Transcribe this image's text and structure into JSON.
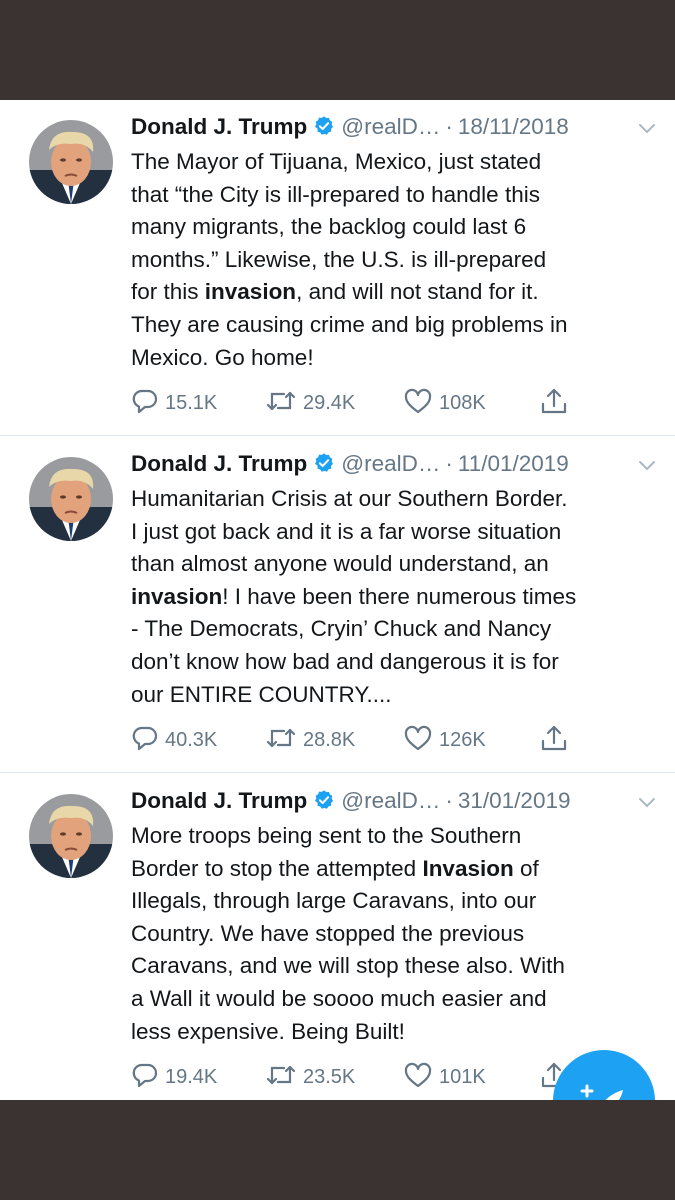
{
  "tweets": [
    {
      "name": "Donald J. Trump",
      "handle": "@realD…",
      "date": "18/11/2018",
      "lines": [
        "The Mayor of Tijuana, Mexico, just stated",
        "that “the City is ill-prepared to handle this",
        "many migrants, the backlog could last 6",
        "months.” Likewise, the U.S. is ill-prepared",
        [
          "for this ",
          "invasion",
          ", and will not stand for it."
        ],
        "They are causing crime and big problems in",
        "Mexico. Go home!"
      ],
      "replies": "15.1K",
      "retweets": "29.4K",
      "likes": "108K"
    },
    {
      "name": "Donald J. Trump",
      "handle": "@realD…",
      "date": "11/01/2019",
      "lines": [
        "Humanitarian Crisis at our Southern Border.",
        "I just got back and it is a far worse situation",
        "than almost anyone would understand, an",
        [
          "",
          "invasion",
          "! I have been there numerous times"
        ],
        "- The Democrats, Cryin’ Chuck and Nancy",
        "don’t know how bad and dangerous it is for",
        "our ENTIRE COUNTRY...."
      ],
      "replies": "40.3K",
      "retweets": "28.8K",
      "likes": "126K"
    },
    {
      "name": "Donald J. Trump",
      "handle": "@realD…",
      "date": "31/01/2019",
      "lines": [
        "More troops being sent to the Southern",
        [
          "Border to stop the attempted ",
          "Invasion",
          " of"
        ],
        "Illegals, through large Caravans, into our",
        "Country. We have stopped the previous",
        "Caravans, and we will stop these also. With",
        "a Wall it would be soooo much easier and",
        "less expensive. Being Built!"
      ],
      "replies": "19.4K",
      "retweets": "23.5K",
      "likes": "101K"
    }
  ],
  "icons": [
    "verified-badge-icon",
    "chevron-down-icon",
    "reply-icon",
    "retweet-icon",
    "like-icon",
    "share-icon",
    "compose-tweet-icon"
  ],
  "colors": {
    "accent": "#1da1f2",
    "secondary_text": "#657786",
    "frame": "#3b3331"
  }
}
